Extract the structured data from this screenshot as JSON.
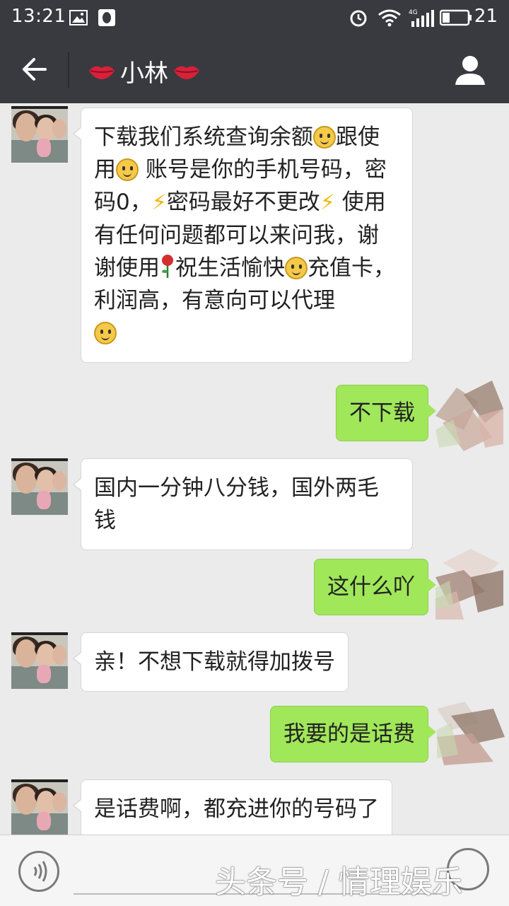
{
  "status_bar": {
    "time": "13:21",
    "battery": "21",
    "network": "4G",
    "icons": [
      "image-icon",
      "qq-icon",
      "alarm-icon",
      "wifi-icon",
      "signal-icon",
      "battery-icon"
    ]
  },
  "header": {
    "title": "小林",
    "icons": [
      "back-arrow-icon",
      "lips-icon",
      "profile-icon"
    ]
  },
  "messages": [
    {
      "side": "in",
      "text_parts": [
        "下载我们系统查询余额",
        "跟使用",
        " 账号是你的手机号码，密码0，",
        "密码最好不更改",
        " 使用有任何问题都可以来问我，谢谢使用",
        "祝生活愉快",
        "充值卡，利润高，有意向可以代理"
      ]
    },
    {
      "side": "out",
      "text": "不下载"
    },
    {
      "side": "in",
      "text": "国内一分钟八分钱，国外两毛钱"
    },
    {
      "side": "out",
      "text": "这什么吖"
    },
    {
      "side": "in",
      "text": "亲！不想下载就得加拨号"
    },
    {
      "side": "out",
      "text": "我要的是话费"
    },
    {
      "side": "in",
      "text": "是话费啊，都充进你的号码了"
    }
  ],
  "bottom": {
    "watermark": "头条号 / 情理娱乐",
    "icons": [
      "voice-icon",
      "emoji-icon"
    ]
  },
  "colors": {
    "header_bg": "#393a3f",
    "chat_bg": "#ebebeb",
    "outgoing_bubble": "#a0e75a",
    "incoming_bubble": "#ffffff"
  }
}
